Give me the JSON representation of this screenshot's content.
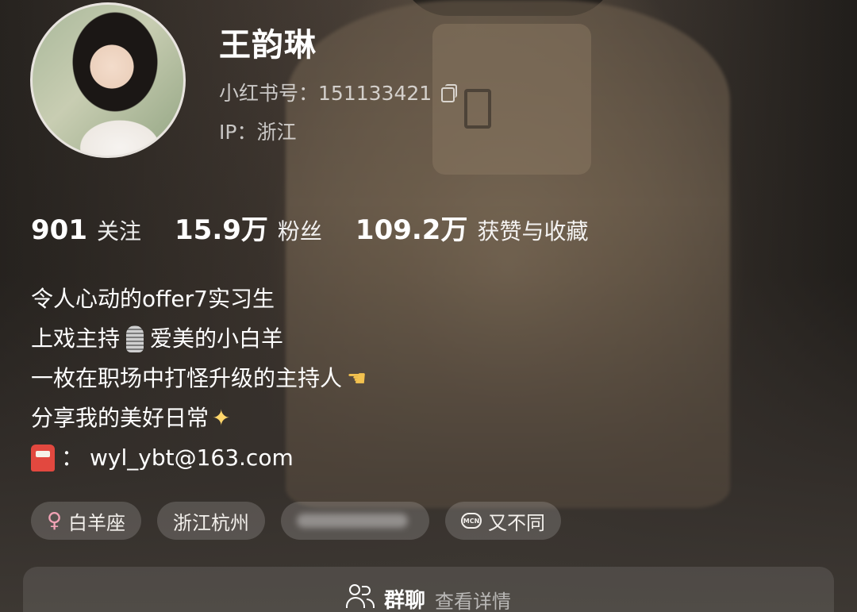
{
  "profile": {
    "name": "王韵琳",
    "xhs_id_label": "小红书号：",
    "xhs_id": "151133421",
    "ip_label": "IP：",
    "ip_location": "浙江"
  },
  "stats": [
    {
      "value": "901",
      "label": "关注"
    },
    {
      "value": "15.9万",
      "label": "粉丝"
    },
    {
      "value": "109.2万",
      "label": "获赞与收藏"
    }
  ],
  "bio": {
    "line1": "令人心动的offer7实习生",
    "line2_a": "上戏主持",
    "line2_b": "爱美的小白羊",
    "line3": "一枚在职场中打怪升级的主持人",
    "line4": "分享我的美好日常",
    "line5_sep": "：",
    "email": "wyl_ybt@163.com"
  },
  "tags": {
    "zodiac": "白羊座",
    "location": "浙江杭州",
    "mcn_icon_text": "MCN",
    "mcn": "又不同"
  },
  "group_chat": {
    "title": "群聊",
    "action": "查看详情"
  },
  "icons": {
    "copy": "copy-icon",
    "microphone": "microphone-emoji",
    "pointing_hand": "pointing-hand-emoji",
    "sparkles": "sparkles-emoji",
    "mailbox": "mailbox-emoji",
    "female": "female-icon",
    "group": "group-icon"
  },
  "colors": {
    "female_symbol": "#f2a3b6",
    "mailbox": "#e2483f",
    "sparkles": "#ffd66b"
  }
}
